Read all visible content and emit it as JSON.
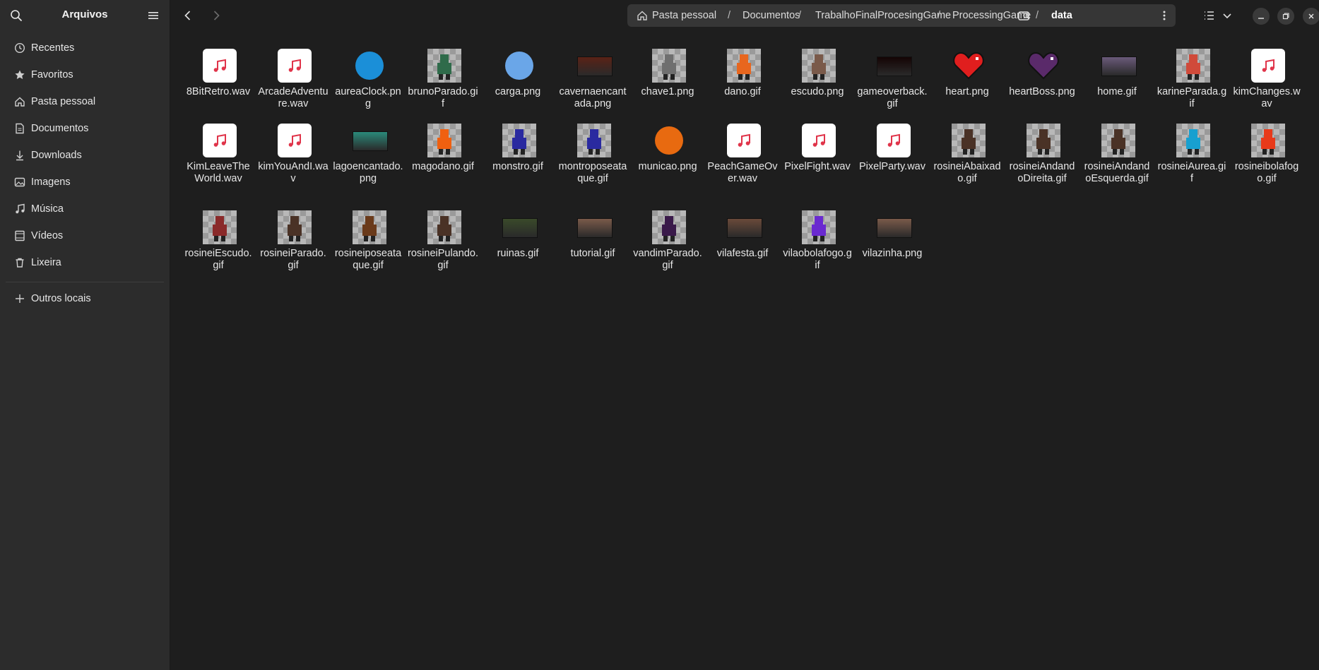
{
  "app": {
    "title": "Arquivos"
  },
  "sidebar": {
    "items": [
      {
        "label": "Recentes",
        "icon": "clock-icon"
      },
      {
        "label": "Favoritos",
        "icon": "star-icon"
      },
      {
        "label": "Pasta pessoal",
        "icon": "home-icon"
      },
      {
        "label": "Documentos",
        "icon": "document-icon"
      },
      {
        "label": "Downloads",
        "icon": "download-icon"
      },
      {
        "label": "Imagens",
        "icon": "image-icon"
      },
      {
        "label": "Música",
        "icon": "music-icon"
      },
      {
        "label": "Vídeos",
        "icon": "video-icon"
      },
      {
        "label": "Lixeira",
        "icon": "trash-icon"
      }
    ],
    "other": {
      "label": "Outros locais",
      "icon": "plus-icon"
    }
  },
  "path": {
    "crumbs": [
      "Pasta pessoal",
      "Documentos",
      "TrabalhoFinalProcesingGame",
      "ProcessingGame",
      "data"
    ]
  },
  "files": [
    {
      "name": "8BitRetro.wav",
      "kind": "audio"
    },
    {
      "name": "ArcadeAdventure.wav",
      "kind": "audio"
    },
    {
      "name": "aureaClock.png",
      "kind": "image",
      "color": "#1b8fd8"
    },
    {
      "name": "brunoParado.gif",
      "kind": "sprite",
      "color": "#2f6b4a"
    },
    {
      "name": "carga.png",
      "kind": "image",
      "color": "#6aa6e8"
    },
    {
      "name": "cavernaencantada.png",
      "kind": "scene",
      "color": "#5a2216"
    },
    {
      "name": "chave1.png",
      "kind": "sprite",
      "color": "#6f6f6f"
    },
    {
      "name": "dano.gif",
      "kind": "sprite",
      "color": "#e8661e"
    },
    {
      "name": "escudo.png",
      "kind": "sprite",
      "color": "#7a5a4a"
    },
    {
      "name": "gameoverback.gif",
      "kind": "scene",
      "color": "#140404"
    },
    {
      "name": "heart.png",
      "kind": "heart",
      "color": "#e01e1e"
    },
    {
      "name": "heartBoss.png",
      "kind": "heart",
      "color": "#5a2a6a"
    },
    {
      "name": "home.gif",
      "kind": "scene",
      "color": "#6a5a7a"
    },
    {
      "name": "karineParada.gif",
      "kind": "sprite",
      "color": "#d04a3a"
    },
    {
      "name": "kimChanges.wav",
      "kind": "audio"
    },
    {
      "name": "KimLeaveTheWorld.wav",
      "kind": "audio"
    },
    {
      "name": "kimYouAndI.wav",
      "kind": "audio"
    },
    {
      "name": "lagoencantado.png",
      "kind": "scene",
      "color": "#2a8a7a"
    },
    {
      "name": "magodano.gif",
      "kind": "sprite",
      "color": "#f06010"
    },
    {
      "name": "monstro.gif",
      "kind": "sprite",
      "color": "#2a2aa0"
    },
    {
      "name": "montroposeataque.gif",
      "kind": "sprite",
      "color": "#2a2aa0"
    },
    {
      "name": "municao.png",
      "kind": "image",
      "color": "#e86a10"
    },
    {
      "name": "PeachGameOver.wav",
      "kind": "audio"
    },
    {
      "name": "PixelFight.wav",
      "kind": "audio"
    },
    {
      "name": "PixelParty.wav",
      "kind": "audio"
    },
    {
      "name": "rosineiAbaixado.gif",
      "kind": "sprite",
      "color": "#4a3226"
    },
    {
      "name": "rosineiAndandoDireita.gif",
      "kind": "sprite",
      "color": "#4a3226"
    },
    {
      "name": "rosineiAndandoEsquerda.gif",
      "kind": "sprite",
      "color": "#4a3226"
    },
    {
      "name": "rosineiAurea.gif",
      "kind": "sprite",
      "color": "#18a0d0"
    },
    {
      "name": "rosineibolafogo.gif",
      "kind": "sprite",
      "color": "#e83a1a"
    },
    {
      "name": "rosineiEscudo.gif",
      "kind": "sprite",
      "color": "#8a2a2a"
    },
    {
      "name": "rosineiParado.gif",
      "kind": "sprite",
      "color": "#4a3226"
    },
    {
      "name": "rosineiposeataque.gif",
      "kind": "sprite",
      "color": "#6a3a1a"
    },
    {
      "name": "rosineiPulando.gif",
      "kind": "sprite",
      "color": "#4a3226"
    },
    {
      "name": "ruinas.gif",
      "kind": "scene",
      "color": "#3a4a2a"
    },
    {
      "name": "tutorial.gif",
      "kind": "scene",
      "color": "#7a5a4a"
    },
    {
      "name": "vandimParado.gif",
      "kind": "sprite",
      "color": "#3a1a4a"
    },
    {
      "name": "vilafesta.gif",
      "kind": "scene",
      "color": "#6a4a3a"
    },
    {
      "name": "vilaobolafogo.gif",
      "kind": "sprite",
      "color": "#6a2ad0"
    },
    {
      "name": "vilazinha.png",
      "kind": "scene",
      "color": "#7a5a4a"
    }
  ]
}
